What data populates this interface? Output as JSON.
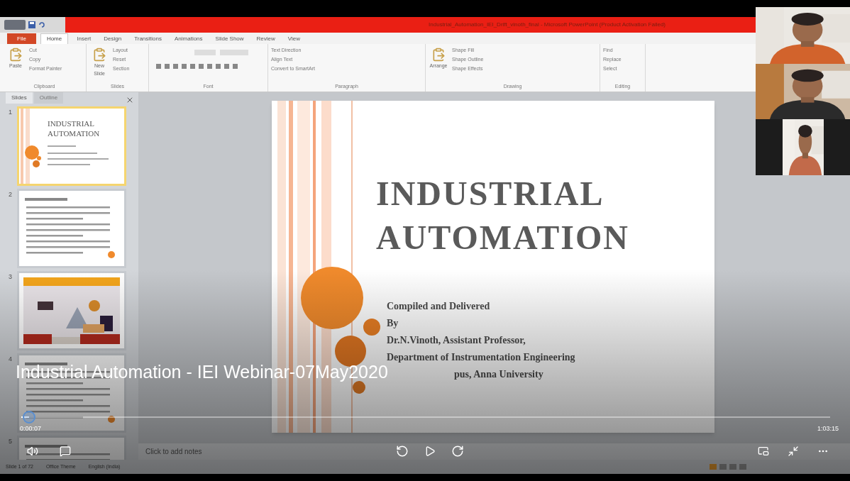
{
  "window": {
    "title": "Industrial_Automation_IEI_Drift_vinoth_final - Microsoft PowerPoint (Product Activation Failed)"
  },
  "ribbon": {
    "tabs": [
      {
        "label": "File",
        "selected": false,
        "kind": "file"
      },
      {
        "label": "Home",
        "selected": true,
        "kind": "tab"
      },
      {
        "label": "Insert",
        "selected": false,
        "kind": "tab"
      },
      {
        "label": "Design",
        "selected": false,
        "kind": "tab"
      },
      {
        "label": "Transitions",
        "selected": false,
        "kind": "tab"
      },
      {
        "label": "Animations",
        "selected": false,
        "kind": "tab"
      },
      {
        "label": "Slide Show",
        "selected": false,
        "kind": "tab"
      },
      {
        "label": "Review",
        "selected": false,
        "kind": "tab"
      },
      {
        "label": "View",
        "selected": false,
        "kind": "tab"
      }
    ],
    "groups": [
      {
        "label": "Clipboard",
        "large": "Paste",
        "items": [
          "Cut",
          "Copy",
          "Format Painter"
        ]
      },
      {
        "label": "Slides",
        "large": "New Slide",
        "items": [
          "Layout",
          "Reset",
          "Section"
        ]
      },
      {
        "label": "Font"
      },
      {
        "label": "Paragraph",
        "items": [
          "Text Direction",
          "Align Text",
          "Convert to SmartArt"
        ]
      },
      {
        "label": "Drawing",
        "large": "Arrange",
        "items": [
          "Shape Fill",
          "Shape Outline",
          "Shape Effects"
        ]
      },
      {
        "label": "Editing",
        "items": [
          "Find",
          "Replace",
          "Select"
        ]
      }
    ]
  },
  "slides_panel": {
    "tabs": [
      {
        "label": "Slides",
        "selected": true
      },
      {
        "label": "Outline",
        "selected": false
      }
    ],
    "thumbnails": [
      {
        "number": "1",
        "selected": true,
        "kind": "title",
        "title": "INDUSTRIAL AUTOMATION"
      },
      {
        "number": "2",
        "selected": false,
        "kind": "text"
      },
      {
        "number": "3",
        "selected": false,
        "kind": "picture"
      },
      {
        "number": "4",
        "selected": false,
        "kind": "text"
      },
      {
        "number": "5",
        "selected": false,
        "kind": "text"
      }
    ]
  },
  "slide": {
    "title_lines": [
      "INDUSTRIAL",
      "AUTOMATION"
    ],
    "lines": [
      "Compiled and Delivered",
      "By",
      "Dr.N.Vinoth, Assistant Professor,",
      "Department of Instrumentation Engineering",
      "pus, Anna University"
    ]
  },
  "notes": {
    "placeholder": "Click to add notes"
  },
  "status_bar": {
    "items": [
      "Slide 1 of 72",
      "Office Theme",
      "English (India)"
    ]
  },
  "player": {
    "title": "Industrial Automation - IEI Webinar-07May2020",
    "elapsed": "0:00:07",
    "duration": "1:03:15",
    "level": 0.01
  }
}
